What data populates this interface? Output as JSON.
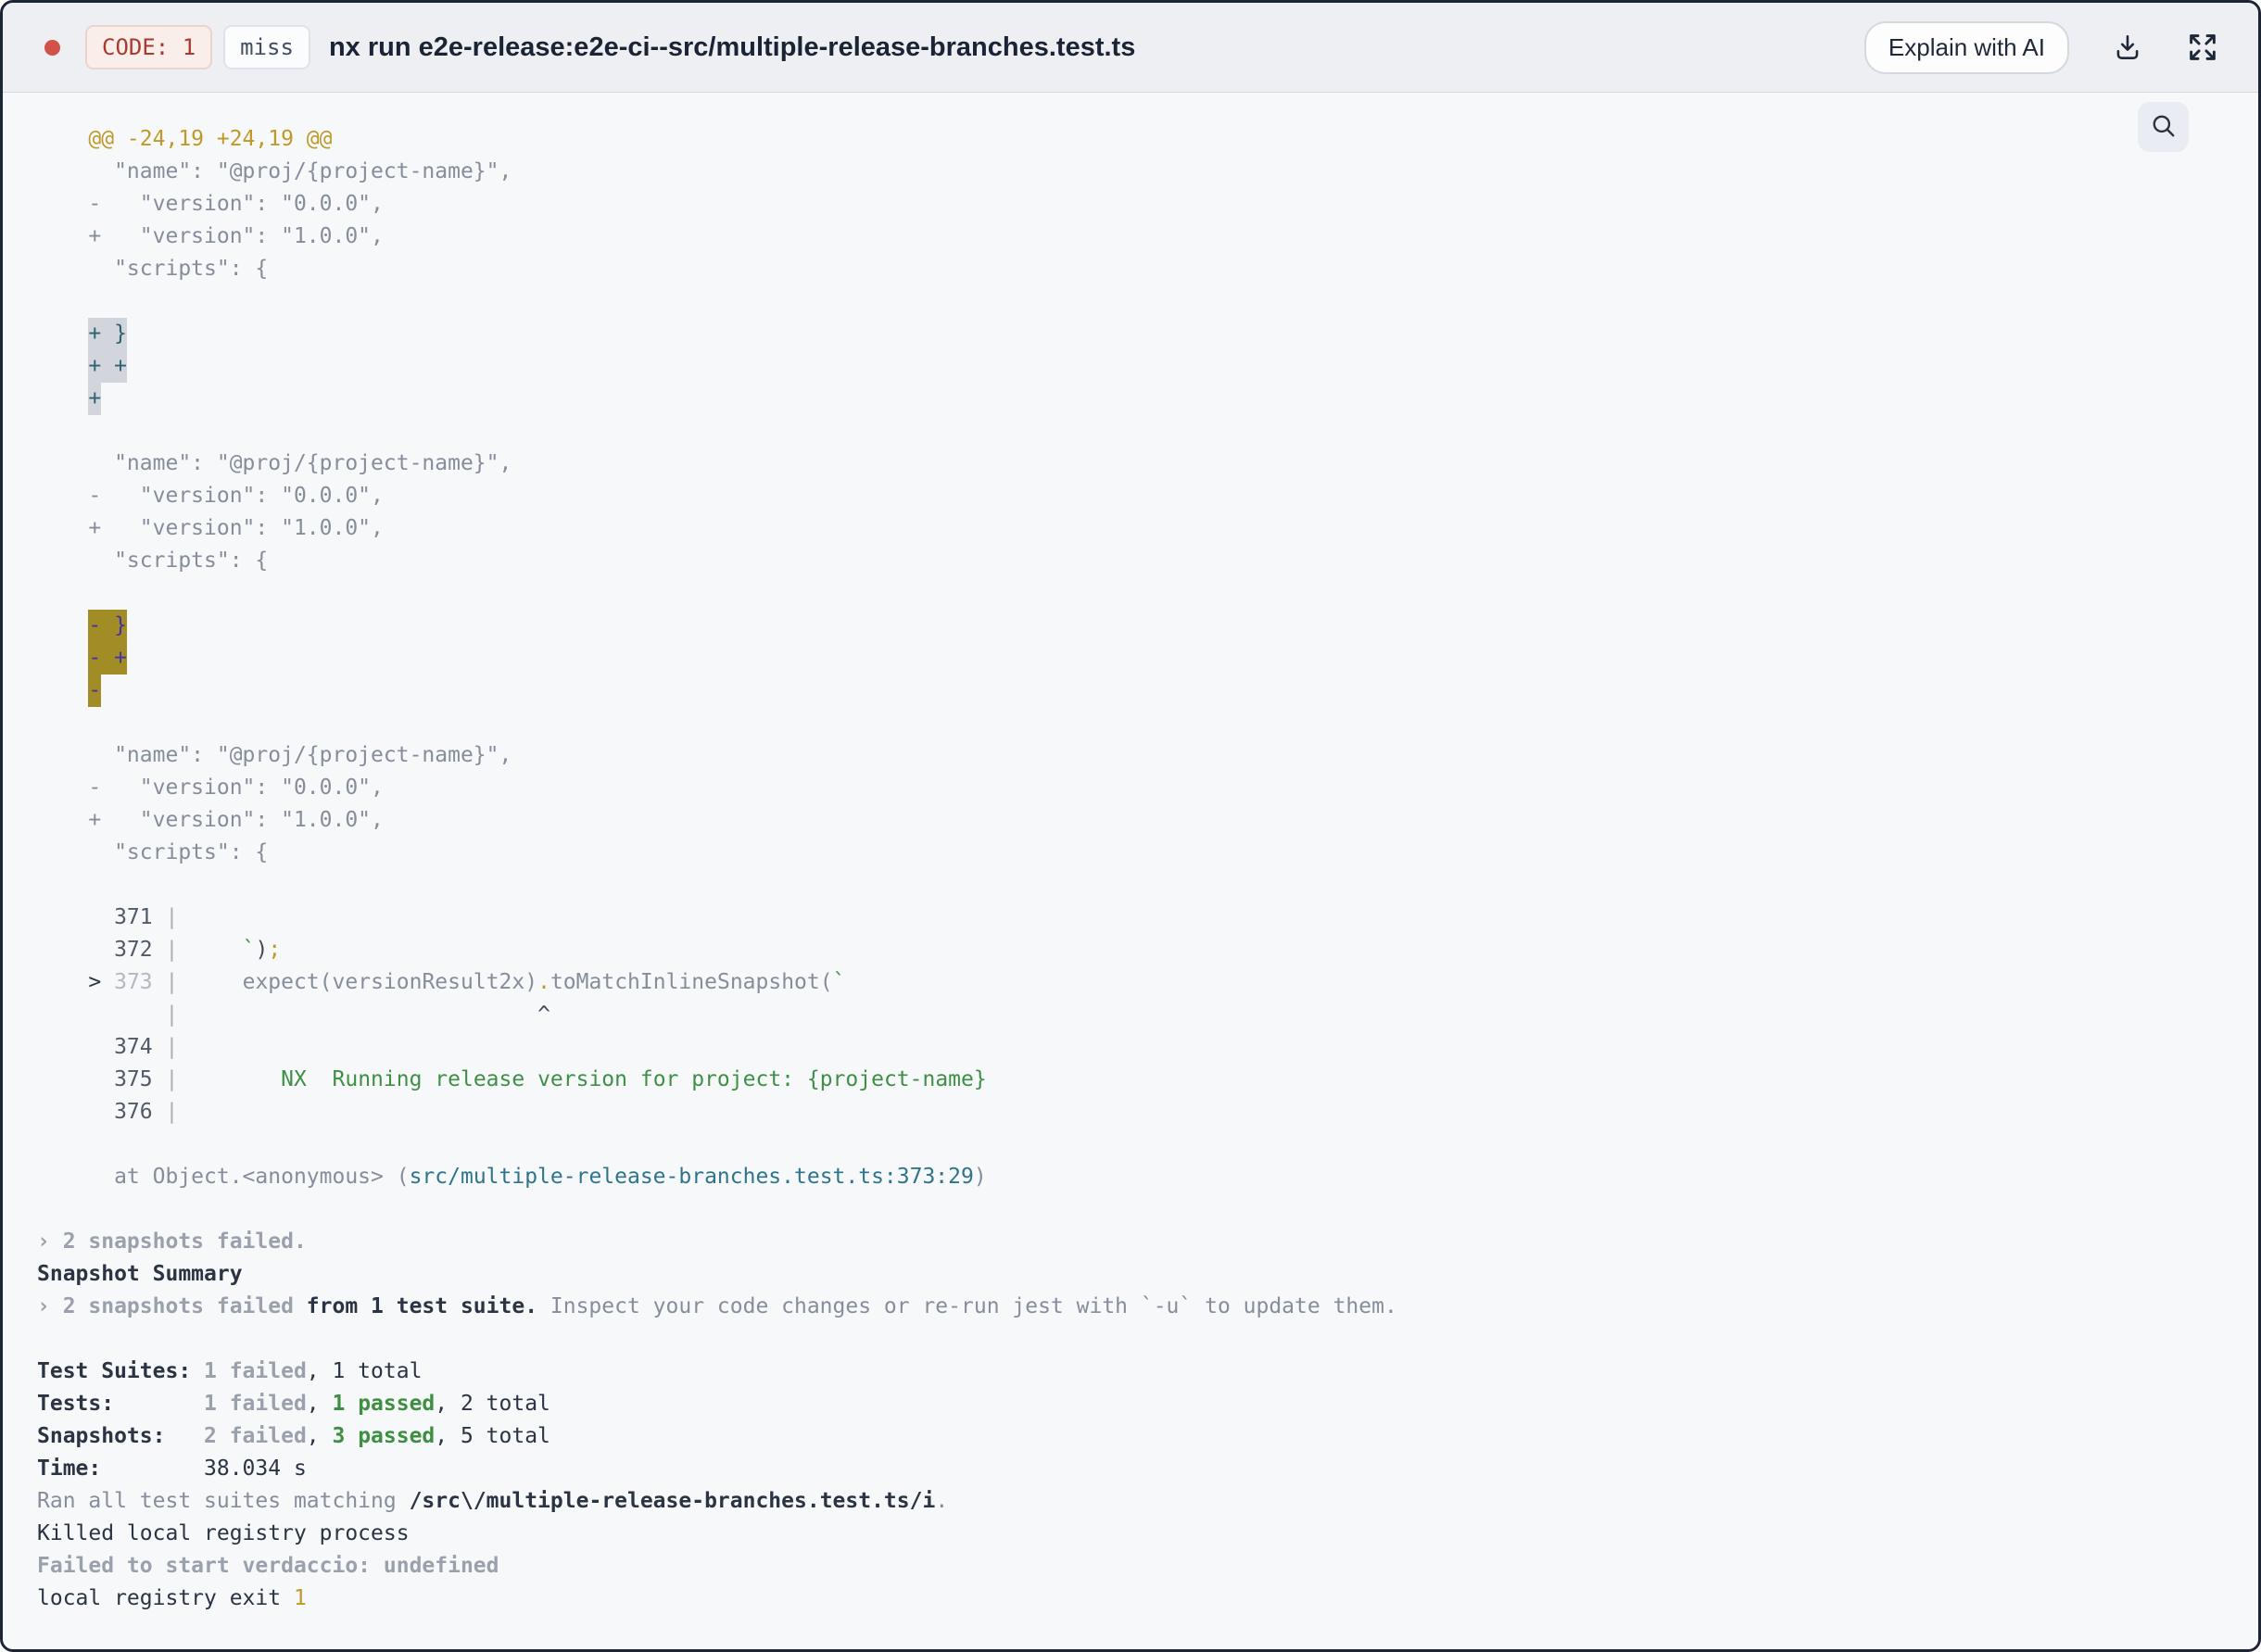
{
  "header": {
    "exit_badge": "CODE: 1",
    "cache_badge": "miss",
    "title": "nx run e2e-release:e2e-ci--src/multiple-release-branches.test.ts",
    "explain_button": "Explain with AI"
  },
  "icons": {
    "status_dot": "red-circle",
    "download": "download-icon",
    "expand": "fullscreen-expand-icon",
    "search": "search-icon"
  },
  "colors": {
    "status_dot": "#d15249",
    "exit_badge_text": "#a93a2d",
    "exit_badge_bg": "#faeeea",
    "diff_hunk_yellow": "#c0992b",
    "pass_green": "#3f8f42",
    "stack_path_teal": "#2f7589",
    "received_highlight_bg": "#d2d6dc",
    "received_highlight_text": "#2e6270",
    "expected_highlight_bg": "#a28c25",
    "expected_highlight_text": "#4732a6",
    "terminal_bg": "#f6f8fa",
    "header_bg": "#edeff3"
  },
  "terminal": {
    "lines": [
      [
        [
          "    @@ -24,19 +24,19 @@",
          "y"
        ]
      ],
      [
        [
          "      \"name\": \"@proj/{project-name}\",",
          "g"
        ]
      ],
      [
        [
          "    -   \"version\": \"0.0.0\",",
          "g"
        ]
      ],
      [
        [
          "    +   \"version\": \"1.0.0\",",
          "g"
        ]
      ],
      [
        [
          "      \"scripts\": {",
          "g"
        ]
      ],
      [],
      [
        [
          "    ",
          "g"
        ],
        [
          "+ }",
          "hr"
        ]
      ],
      [
        [
          "    ",
          "g"
        ],
        [
          "+ +",
          "hr"
        ]
      ],
      [
        [
          "    ",
          "g"
        ],
        [
          "+",
          "hr"
        ]
      ],
      [],
      [
        [
          "      \"name\": \"@proj/{project-name}\",",
          "g"
        ]
      ],
      [
        [
          "    -   \"version\": \"0.0.0\",",
          "g"
        ]
      ],
      [
        [
          "    +   \"version\": \"1.0.0\",",
          "g"
        ]
      ],
      [
        [
          "      \"scripts\": {",
          "g"
        ]
      ],
      [],
      [
        [
          "    ",
          "g"
        ],
        [
          "- }",
          "he"
        ]
      ],
      [
        [
          "    ",
          "g"
        ],
        [
          "- +",
          "he"
        ]
      ],
      [
        [
          "    ",
          "g"
        ],
        [
          "-",
          "he"
        ]
      ],
      [],
      [
        [
          "      \"name\": \"@proj/{project-name}\",",
          "g"
        ]
      ],
      [
        [
          "    -   \"version\": \"0.0.0\",",
          "g"
        ]
      ],
      [
        [
          "    +   \"version\": \"1.0.0\",",
          "g"
        ]
      ],
      [
        [
          "      \"scripts\": {",
          "g"
        ]
      ],
      [],
      [
        [
          "      371 ",
          "ln"
        ],
        [
          "|",
          "p"
        ]
      ],
      [
        [
          "      372 ",
          "ln"
        ],
        [
          "|",
          "p"
        ],
        [
          "     ",
          "g"
        ],
        [
          "`",
          "gr"
        ],
        [
          ")",
          "c"
        ],
        [
          ";",
          "y"
        ]
      ],
      [
        [
          "    ",
          "g"
        ],
        [
          "> ",
          "d"
        ],
        [
          "373",
          "dim"
        ],
        [
          " ",
          "g"
        ],
        [
          "|",
          "p"
        ],
        [
          "     expect(versionResult2x)",
          "g"
        ],
        [
          ".",
          "y"
        ],
        [
          "toMatchInlineSnapshot(",
          "g"
        ],
        [
          "`",
          "gr"
        ]
      ],
      [
        [
          "          ",
          "g"
        ],
        [
          "|",
          "p"
        ],
        [
          "                            ^",
          "c"
        ]
      ],
      [
        [
          "      374 ",
          "ln"
        ],
        [
          "|",
          "p"
        ]
      ],
      [
        [
          "      375 ",
          "ln"
        ],
        [
          "|",
          "p"
        ],
        [
          "        ",
          "g"
        ],
        [
          "NX  Running release version for project: {project-name}",
          "gr"
        ]
      ],
      [
        [
          "      376 ",
          "ln"
        ],
        [
          "|",
          "p"
        ]
      ],
      [],
      [
        [
          "      at Object.<anonymous> (",
          "g"
        ],
        [
          "src/multiple-release-branches.test.ts:373:29",
          "t"
        ],
        [
          ")",
          "g"
        ]
      ],
      [],
      [
        [
          "› 2 snapshots failed.",
          "gb"
        ]
      ],
      [
        [
          "Snapshot Summary",
          "db"
        ]
      ],
      [
        [
          "› 2 snapshots failed ",
          "gb"
        ],
        [
          "from 1 test suite.",
          "db"
        ],
        [
          " Inspect your code changes or re-run jest with `-u` to update them.",
          "g"
        ]
      ],
      [],
      [
        [
          "Test Suites: ",
          "db"
        ],
        [
          "1 failed",
          "gb"
        ],
        [
          ", 1 total",
          "d"
        ]
      ],
      [
        [
          "Tests:       ",
          "db"
        ],
        [
          "1 failed",
          "gb"
        ],
        [
          ", ",
          "d"
        ],
        [
          "1 passed",
          "grb"
        ],
        [
          ", 2 total",
          "d"
        ]
      ],
      [
        [
          "Snapshots:   ",
          "db"
        ],
        [
          "2 failed",
          "gb"
        ],
        [
          ", ",
          "d"
        ],
        [
          "3 passed",
          "grb"
        ],
        [
          ", 5 total",
          "d"
        ]
      ],
      [
        [
          "Time:        ",
          "db"
        ],
        [
          "38.034 s",
          "d"
        ]
      ],
      [
        [
          "Ran all test suites matching ",
          "g"
        ],
        [
          "/src\\/multiple-release-branches.test.ts/i",
          "db"
        ],
        [
          ".",
          "g"
        ]
      ],
      [
        [
          "Killed local registry process",
          "d"
        ]
      ],
      [
        [
          "Failed to start verdaccio: undefined",
          "gb"
        ]
      ],
      [
        [
          "local registry exit ",
          "d"
        ],
        [
          "1",
          "y"
        ]
      ]
    ]
  }
}
